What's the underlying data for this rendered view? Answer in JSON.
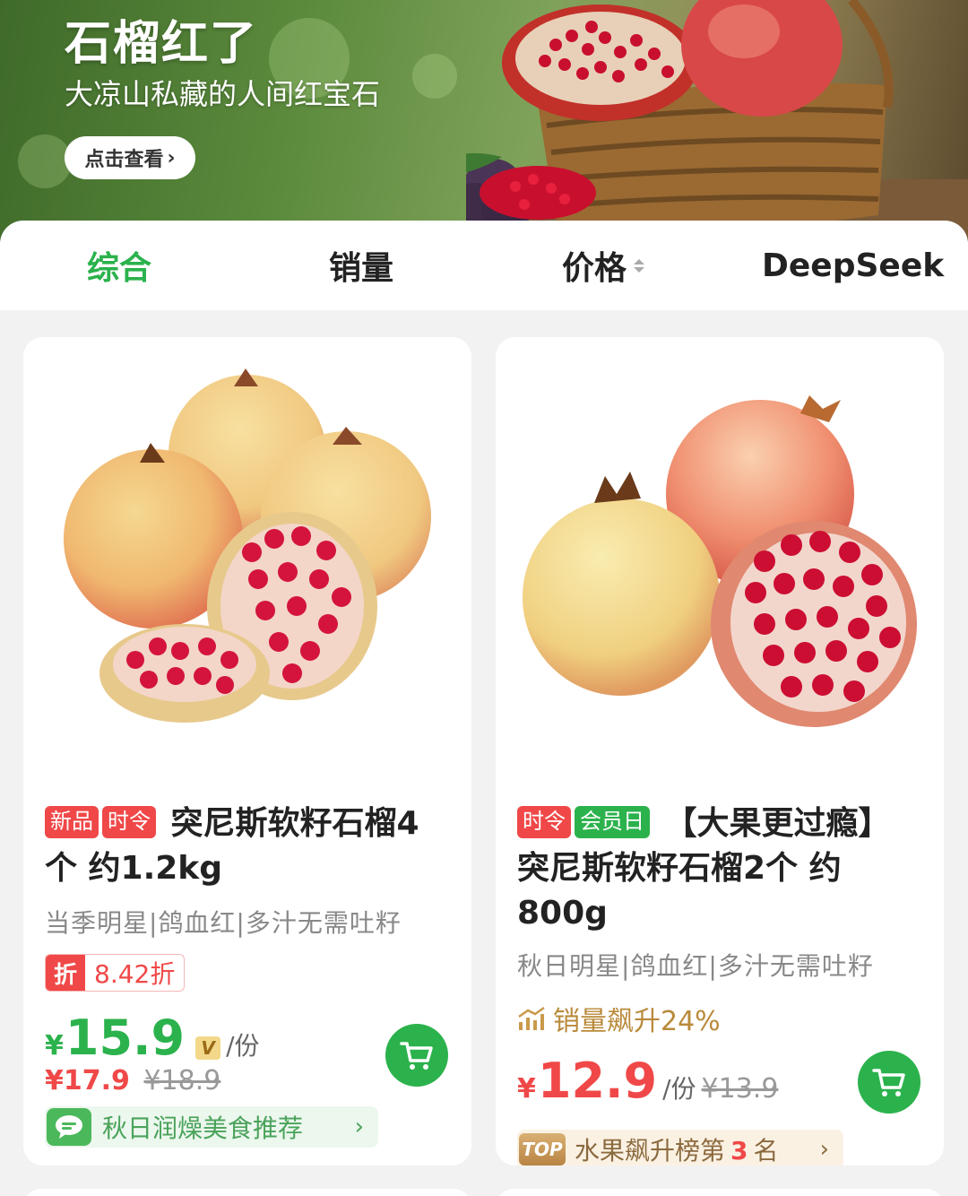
{
  "banner": {
    "title": "石榴红了",
    "subtitle": "大凉山私藏的人间红宝石",
    "button_label": "点击查看"
  },
  "tabs": [
    {
      "label": "综合",
      "active": true
    },
    {
      "label": "销量",
      "active": false
    },
    {
      "label": "价格",
      "active": false
    },
    {
      "label": "DeepSeek",
      "active": false
    }
  ],
  "products": [
    {
      "tags": [
        "新品",
        "时令"
      ],
      "title": "突尼斯软籽石榴4个 约1.2kg",
      "features": "当季明星|鸽血红|多汁无需吐籽",
      "discount_label": "折",
      "discount_value": "8.42折",
      "currency": "¥",
      "price": "15.9",
      "vip_label": "V",
      "unit": "/份",
      "member_price": "¥17.9",
      "original_price": "¥18.9",
      "recommendation": "秋日润燥美食推荐",
      "chevron": "›"
    },
    {
      "tags": [
        "时令",
        "会员日"
      ],
      "title": "【大果更过瘾】突尼斯软籽石榴2个 约800g",
      "features": "秋日明星|鸽血红|多汁无需吐籽",
      "trend": "销量飙升24%",
      "currency": "¥",
      "price": "12.9",
      "unit": "/份",
      "original_price": "¥13.9",
      "top_badge": "TOP",
      "rank_prefix": "水果飙升榜第",
      "rank_number": "3",
      "rank_suffix": "名",
      "chevron": "›"
    }
  ],
  "colors": {
    "brand_green": "#2bb24c",
    "price_red": "#f04848",
    "gold": "#b98a3a"
  }
}
